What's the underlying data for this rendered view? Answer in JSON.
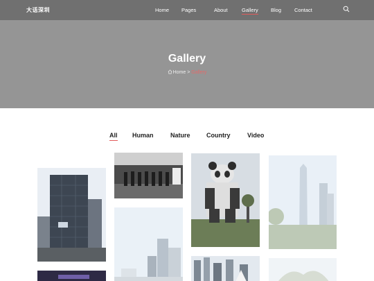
{
  "header": {
    "brand": "大话深圳",
    "nav": [
      {
        "label": "Home"
      },
      {
        "label": "Pages"
      },
      {
        "label": "About"
      },
      {
        "label": "Gallery"
      },
      {
        "label": "Blog"
      },
      {
        "label": "Contact"
      }
    ],
    "active_nav": "Gallery"
  },
  "hero": {
    "title": "Gallery",
    "breadcrumb": {
      "home": "Home",
      "separator": ">",
      "current": "Gallery"
    }
  },
  "filters": [
    {
      "label": "All"
    },
    {
      "label": "Human"
    },
    {
      "label": "Nature"
    },
    {
      "label": "Country"
    },
    {
      "label": "Video"
    }
  ],
  "active_filter": "All",
  "colors": {
    "accent": "#e25b5b",
    "nav_bg": "#707070",
    "hero_bg": "#959595"
  }
}
